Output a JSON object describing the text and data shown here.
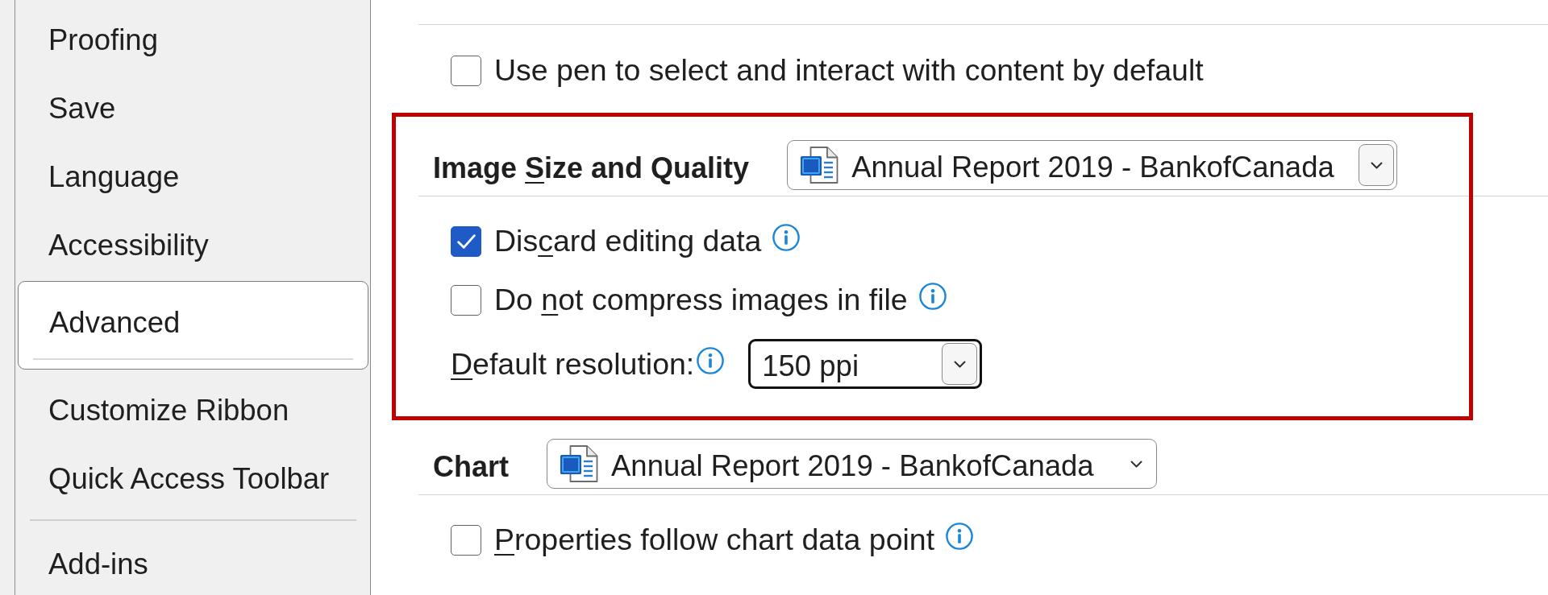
{
  "sidebar": {
    "items": [
      {
        "kind": "item",
        "label": "Proofing",
        "selected": false
      },
      {
        "kind": "item",
        "label": "Save",
        "selected": false
      },
      {
        "kind": "item",
        "label": "Language",
        "selected": false
      },
      {
        "kind": "item",
        "label": "Accessibility",
        "selected": false
      },
      {
        "kind": "item",
        "label": "Advanced",
        "selected": true
      },
      {
        "kind": "item",
        "label": "Customize Ribbon",
        "selected": false
      },
      {
        "kind": "item",
        "label": "Quick Access Toolbar",
        "selected": false
      },
      {
        "kind": "separator"
      },
      {
        "kind": "item",
        "label": "Add-ins",
        "selected": false
      }
    ]
  },
  "content": {
    "options": [
      {
        "kind": "checkbox",
        "label": [
          {
            "text": "Use pen to select and interact with content by default",
            "underlined": false
          }
        ],
        "checked": false,
        "info": false
      }
    ],
    "sections": [
      {
        "heading": [
          {
            "text": "Image ",
            "underlined": false
          },
          {
            "text": "S",
            "underlined": true
          },
          {
            "text": "ize and Quality",
            "underlined": false
          }
        ],
        "highlighted": true,
        "document_picker": {
          "value": "Annual Report 2019 - BankofCanada",
          "hovered": true,
          "focused": false
        },
        "options": [
          {
            "kind": "checkbox",
            "label": [
              {
                "text": "Dis",
                "underlined": false
              },
              {
                "text": "c",
                "underlined": true
              },
              {
                "text": "ard editing data",
                "underlined": false
              }
            ],
            "checked": true,
            "info": true
          },
          {
            "kind": "checkbox",
            "label": [
              {
                "text": "Do ",
                "underlined": false
              },
              {
                "text": "n",
                "underlined": true
              },
              {
                "text": "ot compress images in file",
                "underlined": false
              }
            ],
            "checked": false,
            "info": true
          },
          {
            "kind": "dropdown",
            "label": [
              {
                "text": "D",
                "underlined": true
              },
              {
                "text": "efault resolution:",
                "underlined": false
              }
            ],
            "info": true,
            "value": "150 ppi",
            "hovered": true,
            "focused": true
          }
        ]
      },
      {
        "heading": [
          {
            "text": "Chart",
            "underlined": false
          }
        ],
        "highlighted": false,
        "document_picker": {
          "value": "Annual Report 2019 - BankofCanada",
          "hovered": false,
          "focused": false
        },
        "options": [
          {
            "kind": "checkbox",
            "label": [
              {
                "text": "P",
                "underlined": true
              },
              {
                "text": "roperties follow chart data point",
                "underlined": false
              }
            ],
            "checked": false,
            "info": true
          }
        ]
      }
    ]
  }
}
